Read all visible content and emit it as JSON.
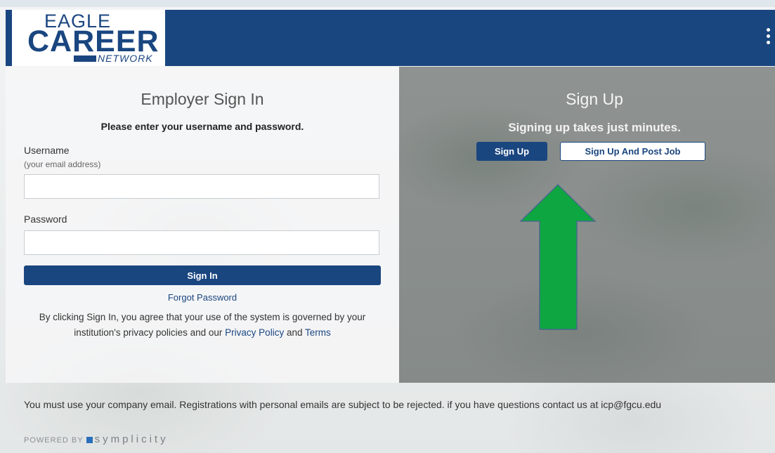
{
  "brand": {
    "line1": "EAGLE",
    "line2": "CAREER",
    "line3": "NETWORK",
    "color": "#1a4680"
  },
  "header": {
    "menu_icon": "vertical-ellipsis-icon"
  },
  "signin": {
    "title": "Employer Sign In",
    "subtitle": "Please enter your username and password.",
    "username_label": "Username",
    "username_hint": "(your email address)",
    "username_value": "",
    "password_label": "Password",
    "password_value": "",
    "button_label": "Sign In",
    "forgot_link": "Forgot Password",
    "legal_prefix": "By clicking Sign In, you agree that your use of the system is governed by your institution's privacy policies and our ",
    "privacy_link": "Privacy Policy",
    "legal_and": " and ",
    "terms_link": "Terms"
  },
  "signup": {
    "title": "Sign Up",
    "subtitle": "Signing up takes just minutes.",
    "signup_button": "Sign Up",
    "signup_post_button": "Sign Up And Post Job",
    "annotation": "green-up-arrow",
    "annotation_color": "#0da640"
  },
  "footer": {
    "notice": "You must use your company email. Registrations with personal emails are subject to be rejected. if you have questions contact us at icp@fgcu.edu",
    "powered_by": "POWERED BY",
    "powered_brand": "symplicity"
  }
}
